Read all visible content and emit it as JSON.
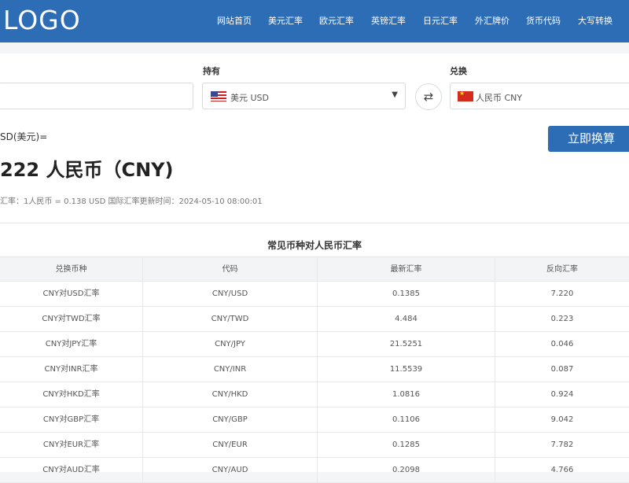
{
  "header": {
    "logo": "LOGO",
    "nav": [
      "网站首页",
      "美元汇率",
      "欧元汇率",
      "英镑汇率",
      "日元汇率",
      "外汇牌价",
      "货币代码",
      "大写转换"
    ]
  },
  "converter": {
    "amount_label": "",
    "amount_value": "",
    "hold_label": "持有",
    "hold_currency": "美元 USD",
    "exchange_label": "兑换",
    "exchange_currency": "人民币 CNY",
    "convert_button": "立即换算",
    "from_text": "SD(美元)=",
    "result_text": "222 人民币（CNY)",
    "rate_info": "汇率：1人民币 = 0.138 USD  国际汇率更新时间：2024-05-10 08:00:01"
  },
  "rates_table": {
    "title": "常见币种对人民币汇率",
    "columns": [
      "兑换币种",
      "代码",
      "最新汇率",
      "反向汇率"
    ],
    "rows": [
      [
        "CNY对USD汇率",
        "CNY/USD",
        "0.1385",
        "7.220"
      ],
      [
        "CNY对TWD汇率",
        "CNY/TWD",
        "4.484",
        "0.223"
      ],
      [
        "CNY对JPY汇率",
        "CNY/JPY",
        "21.5251",
        "0.046"
      ],
      [
        "CNY对INR汇率",
        "CNY/INR",
        "11.5539",
        "0.087"
      ],
      [
        "CNY对HKD汇率",
        "CNY/HKD",
        "1.0816",
        "0.924"
      ],
      [
        "CNY对GBP汇率",
        "CNY/GBP",
        "0.1106",
        "9.042"
      ],
      [
        "CNY对EUR汇率",
        "CNY/EUR",
        "0.1285",
        "7.782"
      ],
      [
        "CNY对AUD汇率",
        "CNY/AUD",
        "0.2098",
        "4.766"
      ]
    ]
  },
  "colors": {
    "brand": "#2d6db5",
    "background": "#f4f5f7"
  }
}
